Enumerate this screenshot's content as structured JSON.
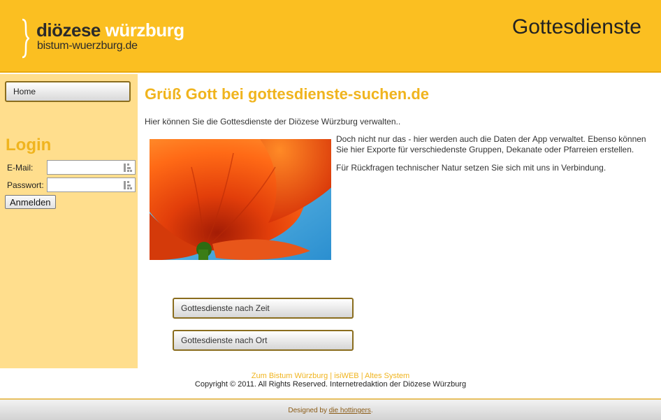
{
  "header": {
    "logo_word1": "diözese",
    "logo_word2": "würzburg",
    "logo_sub": "bistum-wuerzburg.de",
    "page_heading": "Gottesdienste"
  },
  "sidebar": {
    "home_label": "Home",
    "login_title": "Login",
    "email_label": "E-Mail:",
    "password_label": "Passwort:",
    "submit_label": "Anmelden"
  },
  "main": {
    "title": "Grüß Gott bei gottesdienste-suchen.de",
    "intro": "Hier können Sie die Gottesdienste der Diözese Würzburg verwalten..",
    "paragraph1": "Doch nicht nur das - hier werden auch die Daten der App verwaltet. Ebenso können Sie hier Exporte für verschiedenste Gruppen, Dekanate oder Pfarreien erstellen.",
    "paragraph2": "Für Rückfragen technischer Natur setzen Sie sich mit uns in Verbindung.",
    "button_time": "Gottesdienste nach Zeit",
    "button_place": "Gottesdienste nach Ort"
  },
  "footer": {
    "link1": "Zum Bistum Würzburg",
    "sep1": " | ",
    "link2": "isiWEB",
    "sep2": " | ",
    "link3": "Altes System",
    "copyright": "Copyright © 2011. All Rights Reserved. Internetredaktion der Diözese Würzburg",
    "designed_prefix": "Designed by ",
    "designed_link": "die hottingers",
    "designed_suffix": "."
  },
  "icons": {
    "photo": "poppy-flower-image",
    "password_key": "key-icon"
  },
  "colors": {
    "header_bg": "#fbbf21",
    "sidebar_bg": "#ffde8d",
    "accent": "#f0b41e",
    "button_border": "#8a6d1e"
  }
}
